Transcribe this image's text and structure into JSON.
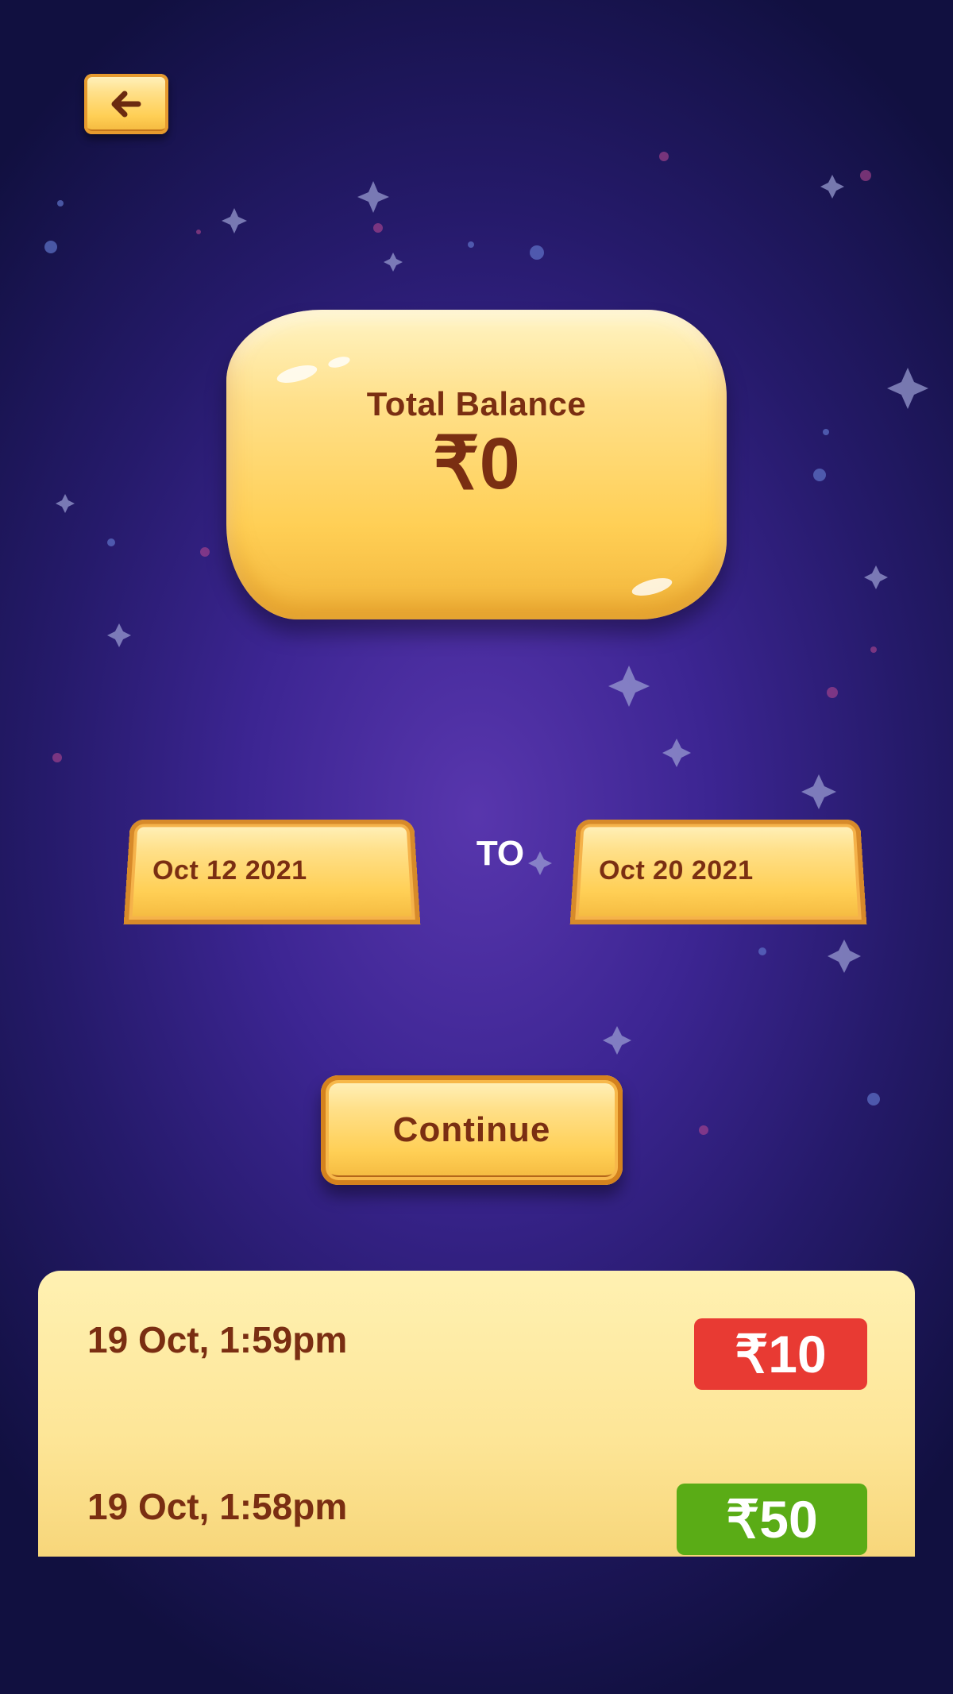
{
  "header": {
    "back_icon": "arrow-left-icon"
  },
  "balance": {
    "label": "Total Balance",
    "value": "₹0"
  },
  "date_range": {
    "from": "Oct 12 2021",
    "separator": "TO",
    "to": "Oct 20 2021"
  },
  "actions": {
    "continue_label": "Continue"
  },
  "transactions": [
    {
      "datetime": "19 Oct, 1:59pm",
      "amount": "₹10",
      "status_color": "#e83a33"
    },
    {
      "datetime": "19 Oct, 1:58pm",
      "amount": "₹50",
      "status_color": "#5aac16"
    }
  ],
  "colors": {
    "gold": "#ffcf55",
    "text_brown": "#7a2e12",
    "background": "#3c2592"
  }
}
